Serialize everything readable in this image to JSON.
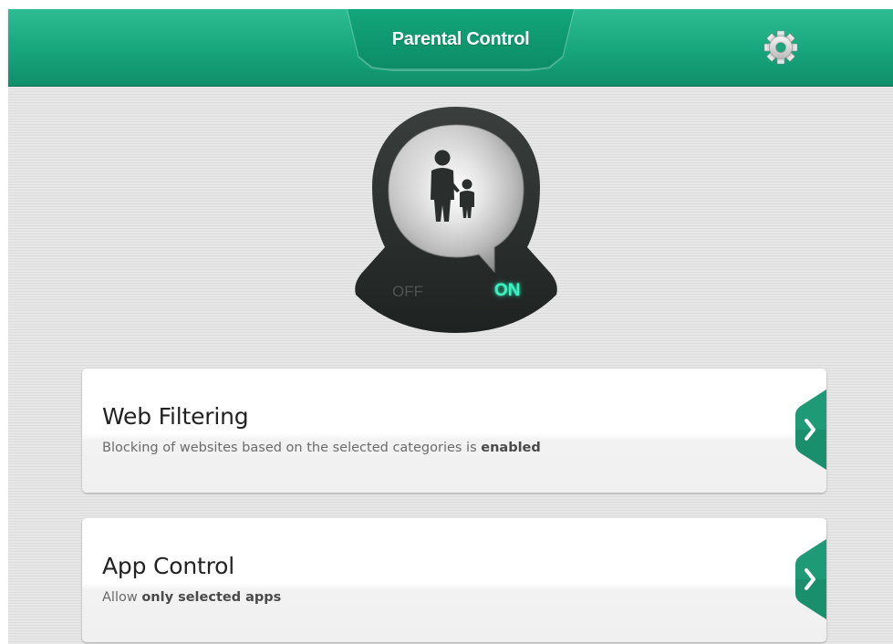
{
  "header": {
    "title": "Parental Control",
    "settings_icon": "gear-icon"
  },
  "toggle": {
    "icon": "parent-child-icon",
    "off_label": "OFF",
    "on_label": "ON",
    "state": "on"
  },
  "cards": [
    {
      "title": "Web Filtering",
      "subtitle_prefix": "Blocking of websites based on the selected categories is ",
      "subtitle_bold": "enabled",
      "subtitle_suffix": "",
      "arrow_icon": "chevron-right-icon"
    },
    {
      "title": "App Control",
      "subtitle_prefix": "Allow ",
      "subtitle_bold": "only selected apps",
      "subtitle_suffix": "",
      "arrow_icon": "chevron-right-icon"
    }
  ],
  "colors": {
    "brand_green": "#17a57b",
    "accent_glow": "#3df1c2",
    "arrow_tab": "#1a8f6c"
  }
}
